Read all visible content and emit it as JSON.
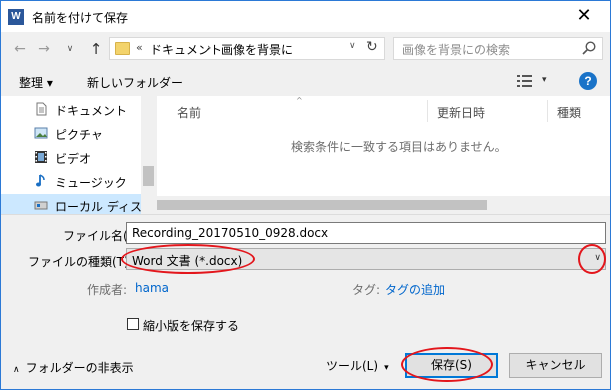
{
  "window": {
    "title": "名前を付けて保存",
    "app_icon": "W",
    "close_glyph": "✕"
  },
  "nav": {
    "back_glyph": "←",
    "forward_glyph": "→",
    "recent_glyph": "∨",
    "up_glyph": "↑"
  },
  "address": {
    "chevron": "«",
    "crumb_a": "ドキュメント",
    "separator": "›",
    "crumb_b": "画像を背景に",
    "dropdown_glyph": "∨",
    "refresh_glyph": "↻"
  },
  "search": {
    "placeholder": "画像を背景にの検索"
  },
  "toolbar": {
    "organize_label": "整理 ▾",
    "new_folder_label": "新しいフォルダー",
    "view_dropdown_glyph": "▾",
    "help_glyph": "?"
  },
  "sidebar": {
    "items": [
      {
        "label": "ドキュメント",
        "icon": "document-icon"
      },
      {
        "label": "ピクチャ",
        "icon": "pictures-icon"
      },
      {
        "label": "ビデオ",
        "icon": "video-icon"
      },
      {
        "label": "ミュージック",
        "icon": "music-icon"
      },
      {
        "label": "ローカル ディスク (C",
        "icon": "disk-icon"
      }
    ]
  },
  "file_list": {
    "columns": [
      "名前",
      "更新日時",
      "種類"
    ],
    "sort_glyph": "^",
    "empty_message": "検索条件に一致する項目はありません。"
  },
  "form": {
    "filename_label": "ファイル名(N):",
    "filename_value": "Recording_20170510_0928.docx",
    "type_label": "ファイルの種類(T):",
    "type_value": "Word 文書 (*.docx)",
    "type_dropdown_glyph": "∨",
    "author_label": "作成者:",
    "author_value": "hama",
    "tags_label": "タグ:",
    "tags_value": "タグの追加",
    "thumbnail_label": "縮小版を保存する"
  },
  "footer": {
    "hide_folders_chevron": "∧",
    "hide_folders_label": "フォルダーの非表示",
    "tools_label": "ツール(L)",
    "tools_dropdown_glyph": "▾",
    "save_label": "保存(S)",
    "cancel_label": "キャンセル"
  },
  "colors": {
    "accent": "#0078d7",
    "annotation": "#e3161c",
    "link": "#0066cc",
    "selection": "#cce8ff"
  }
}
